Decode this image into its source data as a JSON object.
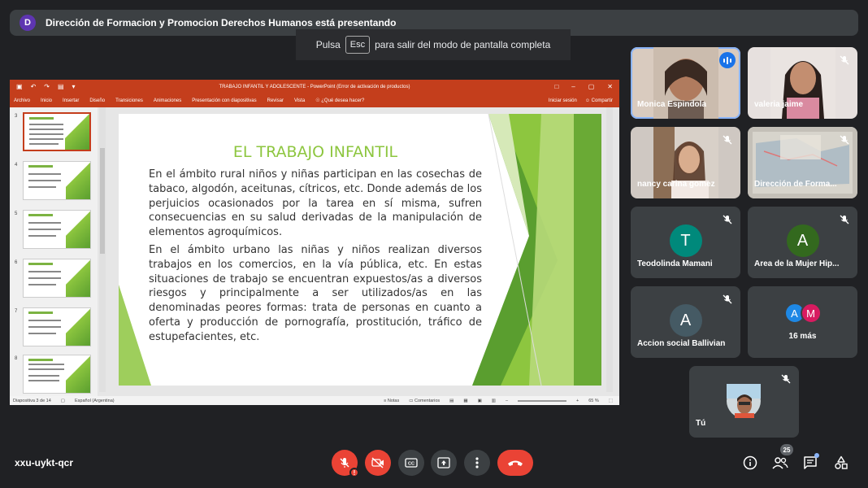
{
  "presenting": {
    "initial": "D",
    "text": "Dirección de Formacion y Promocion Derechos Humanos está presentando"
  },
  "esc_hint": {
    "prefix": "Pulsa",
    "key": "Esc",
    "suffix": "para salir del modo de pantalla completa"
  },
  "ppt": {
    "title": "TRABAJO INFANTIL Y ADOLESCENTE - PowerPoint (Error de activación de productos)",
    "menu": [
      "Archivo",
      "Inicio",
      "Insertar",
      "Diseño",
      "Transiciones",
      "Animaciones",
      "Presentación con diapositivas",
      "Revisar",
      "Vista",
      "¿Qué desea hacer?"
    ],
    "signin": "Iniciar sesión",
    "share": "Compartir",
    "thumbnail_numbers": [
      "3",
      "4",
      "5",
      "6",
      "7",
      "8"
    ],
    "slide": {
      "title": "EL TRABAJO INFANTIL",
      "p1_a": "En el ",
      "p1_bold": "ámbito rural",
      "p1_b": " niños y niñas participan en las cosechas de tabaco, algodón, aceitunas, cítricos, etc. Donde además de los perjuicios ocasionados por la tarea en sí misma, sufren consecuencias en su salud derivadas de la manipulación de elementos agroquímicos.",
      "p2_a": "En el ",
      "p2_bold": "ámbito urbano",
      "p2_b": " las niñas y niños realizan diversos trabajos en los comercios, en la vía pública, etc. En estas situaciones de trabajo se encuentran expuestos/as a diversos riesgos y principalmente a ser utilizados/as en las denominadas ",
      "p2_bold2": "peores formas",
      "p2_c": ": trata de personas en cuanto a oferta y producción de pornografía, prostitución, tráfico de estupefacientes, etc."
    },
    "status": {
      "slide_info": "Diapositiva 3 de 14",
      "language": "Español (Argentina)",
      "notes": "Notas",
      "comments": "Comentarios",
      "zoom": "65 %"
    }
  },
  "participants": [
    {
      "name": "Monica Espindola",
      "speaking": true
    },
    {
      "name": "valeria jaime",
      "muted": true
    },
    {
      "name": "nancy carina gomez",
      "muted": true
    },
    {
      "name": "Dirección de Forma...",
      "muted": true
    },
    {
      "name": "Teodolinda Mamani",
      "initial": "T",
      "color": "#00897b",
      "muted": true
    },
    {
      "name": "Area de la Mujer Hip...",
      "initial": "A",
      "color": "#33691e",
      "muted": true
    },
    {
      "name": "Accion social Ballivian",
      "initial": "A",
      "color": "#455a64",
      "muted": true
    },
    {
      "name": "Tú",
      "muted": true
    }
  ],
  "more": {
    "avatars": [
      {
        "initial": "A",
        "color": "#1e88e5"
      },
      {
        "initial": "M",
        "color": "#d81b60"
      }
    ],
    "label": "16 más"
  },
  "bottom": {
    "meeting_code": "xxu-uykt-qcr",
    "participant_count": "25",
    "warn_mark": "!"
  },
  "colors": {
    "background": "#202124",
    "tile": "#3c4043",
    "danger": "#ea4335",
    "ppt_accent": "#c43e1c",
    "slide_green": "#8dc63f"
  }
}
